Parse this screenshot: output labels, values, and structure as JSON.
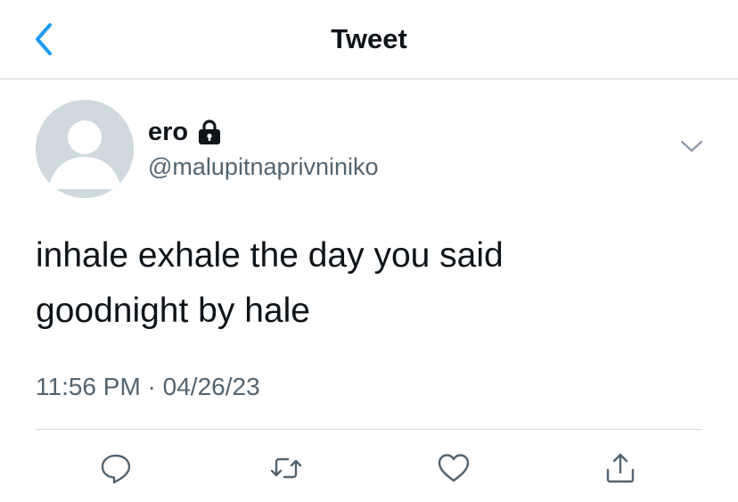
{
  "header": {
    "title": "Tweet",
    "back_icon": "chevron-left-icon"
  },
  "tweet": {
    "display_name": "ero",
    "protected_icon": "lock-icon",
    "handle": "@malupitnaprivniniko",
    "text_line1": "inhale exhale the day you said",
    "text_line2": "goodnight by hale",
    "timestamp": "11:56 PM · 04/26/23"
  },
  "actions": [
    {
      "name": "reply",
      "icon": "reply-icon"
    },
    {
      "name": "retweet",
      "icon": "retweet-icon"
    },
    {
      "name": "like",
      "icon": "heart-icon"
    },
    {
      "name": "share",
      "icon": "share-icon"
    }
  ],
  "colors": {
    "accent": "#1d9bf0",
    "text": "#0f1419",
    "secondary_text": "#536471",
    "avatar_bg": "#cfd9de",
    "divider": "#d4d8dc"
  }
}
